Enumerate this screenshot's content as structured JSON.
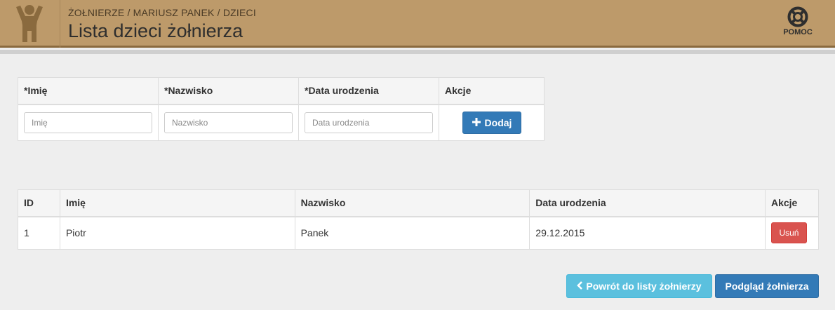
{
  "header": {
    "breadcrumb": "ŻOŁNIERZE / MARIUSZ PANEK / DZIECI",
    "title": "Lista dzieci żołnierza",
    "help_label": "POMOC",
    "logo_icon": "child-figure-icon",
    "help_icon": "lifebuoy-icon"
  },
  "form": {
    "headers": [
      "*Imię",
      "*Nazwisko",
      "*Data urodzenia",
      "Akcje"
    ],
    "placeholders": {
      "first_name": "Imię",
      "last_name": "Nazwisko",
      "birth_date": "Data urodzenia"
    },
    "values": {
      "first_name": "",
      "last_name": "",
      "birth_date": ""
    },
    "add_label": "Dodaj",
    "add_icon": "plus-icon"
  },
  "list": {
    "headers": [
      "ID",
      "Imię",
      "Nazwisko",
      "Data urodzenia",
      "Akcje"
    ],
    "rows": [
      {
        "id": "1",
        "first_name": "Piotr",
        "last_name": "Panek",
        "birth_date": "29.12.2015",
        "delete_label": "Usuń"
      }
    ]
  },
  "footer": {
    "back_label": "Powrót do listy żołnierzy",
    "back_icon": "chevron-left-icon",
    "view_label": "Podgląd żołnierza"
  },
  "colors": {
    "header_bg": "#bd9a6a",
    "header_border": "#8a6a3e",
    "primary": "#337ab7",
    "info": "#5bc0de",
    "danger": "#d9534f"
  }
}
